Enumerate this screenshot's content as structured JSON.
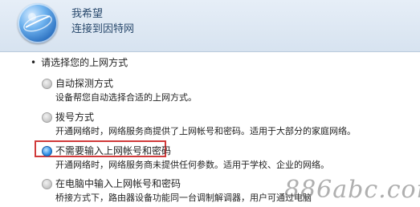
{
  "header": {
    "title": "我希望",
    "subtitle": "连接到因特网"
  },
  "section": {
    "label": "请选择您的上网方式"
  },
  "options": [
    {
      "title": "自动探测方式",
      "desc": "设备帮您自动选择合适的上网方式。",
      "selected": false
    },
    {
      "title": "拨号方式",
      "desc": "开通网络时，网络服务商提供了上网帐号和密码。适用于大部分的家庭网络。",
      "selected": false
    },
    {
      "title": "不需要输入上网帐号和密码",
      "desc": "开通网络时，网络服务商未提供任何参数。适用于学校、企业的网络。",
      "selected": true
    },
    {
      "title": "在电脑中输入上网帐号和密码",
      "desc": "桥接方式下，路由器设备功能同一台调制解调器，用户可通过电脑",
      "selected": false
    }
  ],
  "watermark": "886abc.com",
  "colors": {
    "accent": "#2f8fe6",
    "highlight": "#d03a3a"
  }
}
